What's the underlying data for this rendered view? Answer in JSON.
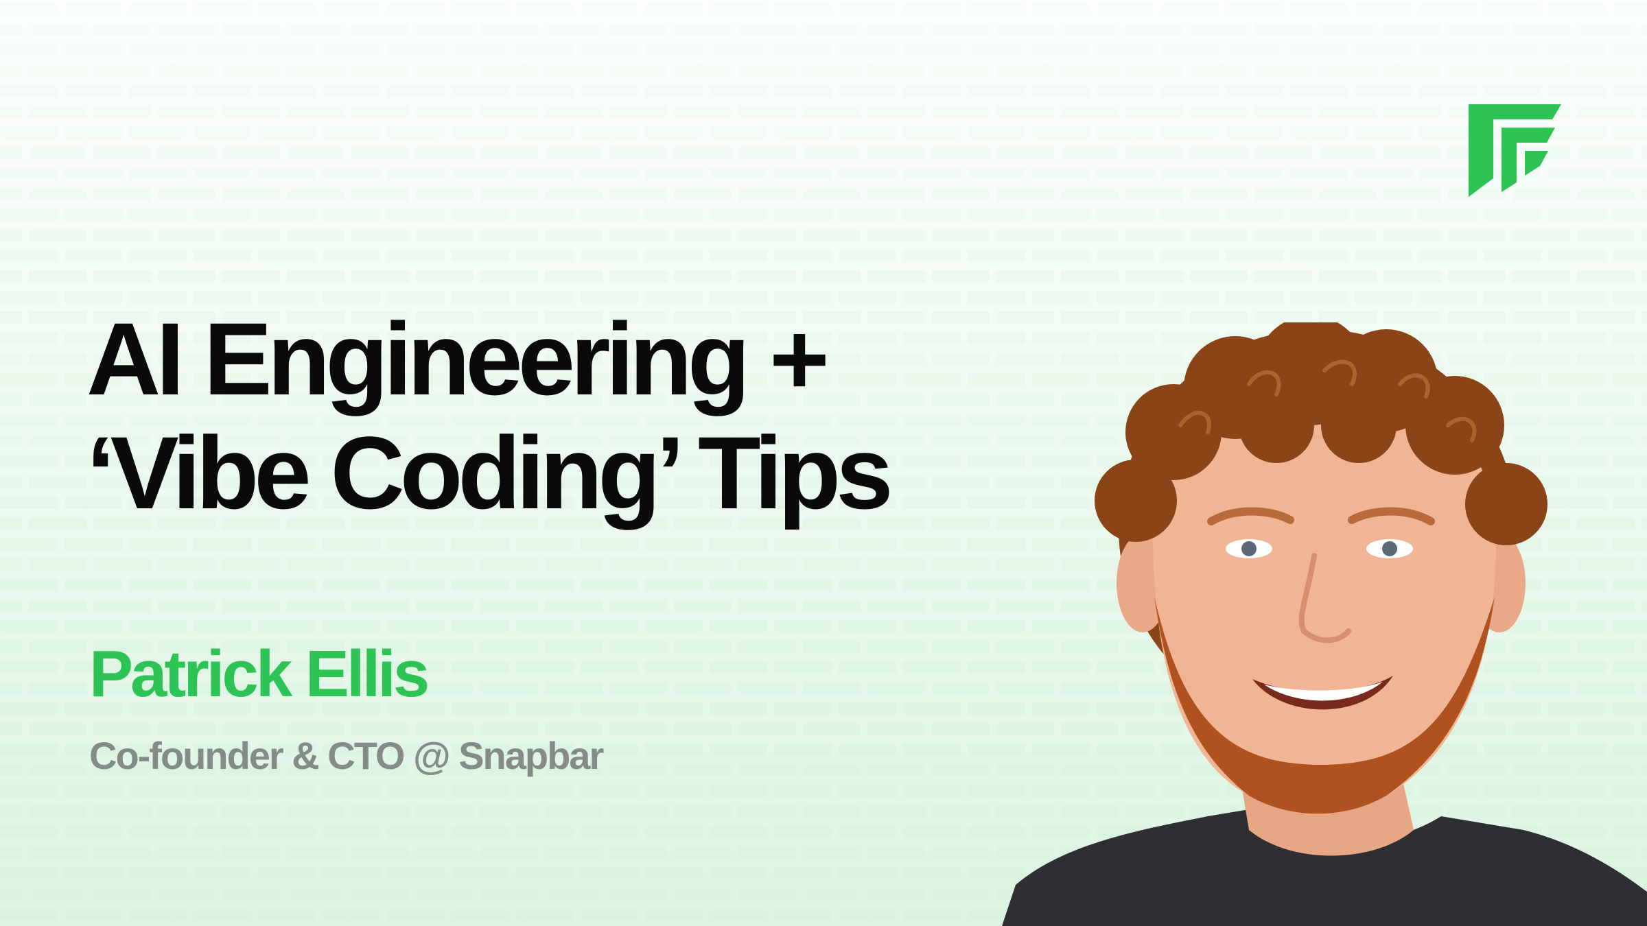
{
  "slide": {
    "title_lines": [
      "AI Engineering +",
      "‘Vibe Coding’ Tips"
    ],
    "speaker": {
      "name": "Patrick Ellis",
      "role": "Co-founder & CTO @ Snapbar"
    },
    "logo_icon": "brand-logo-icon",
    "portrait": "speaker-portrait-photo"
  },
  "colors": {
    "background": "#f2fbf4",
    "pattern": "#d3f0da",
    "title": "#0a0a0a",
    "accent_green": "#2ec455",
    "role_gray": "#858c87",
    "hair": "#8a4418",
    "skin": "#f0b594",
    "beard": "#b0521f",
    "shirt": "#2f2f33"
  }
}
